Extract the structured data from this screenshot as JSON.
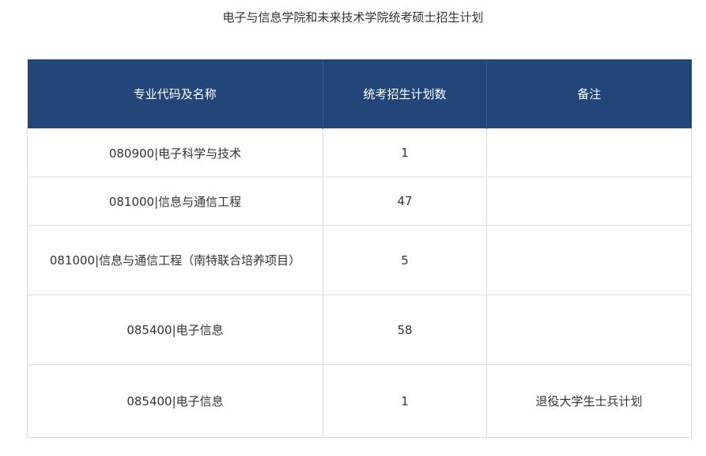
{
  "title": "电子与信息学院和未来技术学院统考硕士招生计划",
  "table": {
    "headers": [
      "专业代码及名称",
      "统考招生计划数",
      "备注"
    ],
    "rows": [
      {
        "major": "080900|电子科学与技术",
        "count": "1",
        "note": ""
      },
      {
        "major": "081000|信息与通信工程",
        "count": "47",
        "note": ""
      },
      {
        "major": "081000|信息与通信工程（南特联合培养项目）",
        "count": "5",
        "note": ""
      },
      {
        "major": "085400|电子信息",
        "count": "58",
        "note": ""
      },
      {
        "major": "085400|电子信息",
        "count": "1",
        "note": "退役大学生士兵计划"
      }
    ]
  },
  "colors": {
    "header_background": "#23467a",
    "header_text": "#ffffff",
    "border": "#dedede",
    "text": "#333333"
  }
}
